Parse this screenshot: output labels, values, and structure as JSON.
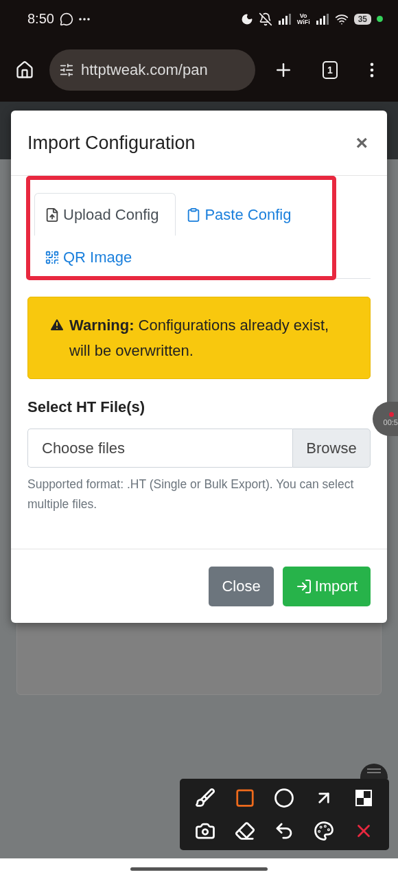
{
  "status_bar": {
    "time": "8:50",
    "vowifi_top": "Vo",
    "vowifi_bottom": "WiFi",
    "battery": "35"
  },
  "browser": {
    "url": "httptweak.com/pan",
    "tab_count": "1"
  },
  "modal": {
    "title": "Import Configuration",
    "close": "×",
    "tabs": [
      {
        "label": "Upload Config",
        "kind": "upload",
        "selected": true
      },
      {
        "label": "Paste Config",
        "kind": "paste",
        "selected": false
      },
      {
        "label": "QR Image",
        "kind": "qr",
        "selected": false
      }
    ],
    "warning": "**Warning:** Configurations already exist, will be overwritten.",
    "field_label": "Select HT File(s)",
    "file_input": {
      "placeholder": "Choose files",
      "button": "Browse"
    },
    "help": "Supported format: .HT (Single or Bulk Export). You can select multiple files.",
    "buttons": [
      {
        "label": "Close",
        "kind": "secondary"
      },
      {
        "label": "Import",
        "kind": "primary"
      }
    ]
  },
  "recorder": {
    "time": "00:5"
  },
  "annotation_toolbar": {
    "tools": [
      {
        "kind": "brush",
        "selected": false
      },
      {
        "kind": "rectangle",
        "selected": true
      },
      {
        "kind": "circle",
        "selected": false
      },
      {
        "kind": "arrow",
        "selected": false
      },
      {
        "kind": "mosaic",
        "selected": false
      },
      {
        "kind": "camera",
        "selected": false
      },
      {
        "kind": "eraser",
        "selected": false
      },
      {
        "kind": "undo",
        "selected": false
      },
      {
        "kind": "palette",
        "selected": false
      },
      {
        "kind": "close",
        "selected": false
      }
    ]
  }
}
